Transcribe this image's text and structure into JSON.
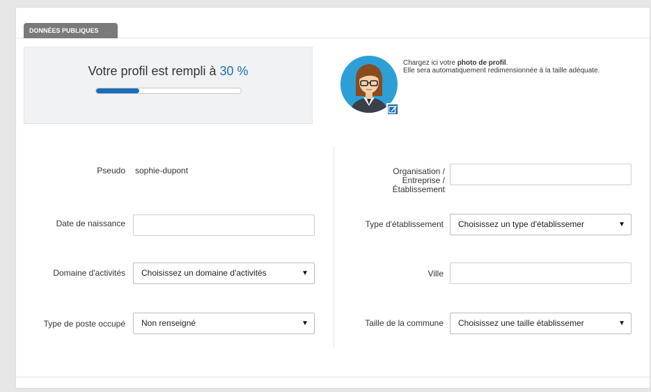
{
  "tab": {
    "label": "DONNÉES PUBLIQUES"
  },
  "profile_progress": {
    "prefix": "Votre profil est rempli à",
    "percent_label": "30 %",
    "fraction": 0.3
  },
  "photo": {
    "line1_prefix": "Chargez ici votre ",
    "line1_bold": "photo de profil",
    "line1_suffix": ".",
    "line2": "Elle sera automatiquement redimensionnée à la taille adéquate."
  },
  "colors": {
    "accent": "#1b6db6",
    "avatar_bg": "#2e9fd6"
  },
  "form": {
    "pseudo_label": "Pseudo",
    "pseudo_value": "sophie-dupont",
    "birthdate_label": "Date de naissance",
    "birthdate_value": "",
    "domain_label": "Domaine d'activités",
    "domain_value": "Choisissez un domaine d'activités",
    "job_label": "Type de poste occupé",
    "job_value": "Non renseigné",
    "org_label_line1": "Organisation /",
    "org_label_line2": "Entreprise /",
    "org_label_line3": "Établissement",
    "org_value": "",
    "estab_type_label": "Type d'établissement",
    "estab_type_value": "Choisissez un type d'établissemer",
    "city_label": "Ville",
    "city_value": "",
    "town_size_label": "Taille de la commune",
    "town_size_value": "Choisissez une taille établissemer"
  },
  "icons": {
    "dropdown": "▼",
    "edit": "edit-icon"
  }
}
